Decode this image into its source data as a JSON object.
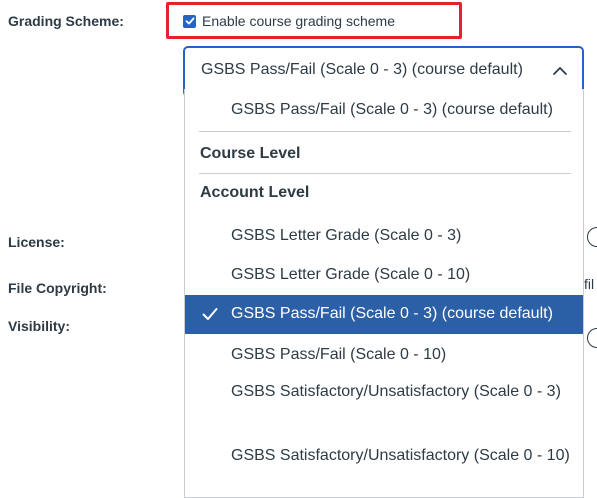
{
  "form": {
    "grading_scheme_label": "Grading Scheme:",
    "license_label": "License:",
    "file_copyright_label": "File Copyright:",
    "visibility_label": "Visibility:"
  },
  "enable_checkbox": {
    "label": "Enable course grading scheme",
    "checked": true
  },
  "select": {
    "value": "GSBS Pass/Fail (Scale 0 - 3) (course default)",
    "expanded": true
  },
  "dropdown": {
    "current_option": "GSBS Pass/Fail (Scale 0 - 3) (course default)",
    "course_level_header": "Course Level",
    "account_level_header": "Account Level",
    "options": [
      {
        "label": "GSBS Letter Grade (Scale 0 - 3)",
        "selected": false
      },
      {
        "label": "GSBS Letter Grade (Scale 0 - 10)",
        "selected": false
      },
      {
        "label": "GSBS Pass/Fail (Scale 0 - 3) (course default)",
        "selected": true
      },
      {
        "label": "GSBS Pass/Fail (Scale 0 - 10)",
        "selected": false
      },
      {
        "label": "GSBS Satisfactory/Unsatisfactory (Scale 0 - 3)",
        "selected": false
      },
      {
        "label": "GSBS Satisfactory/Unsatisfactory (Scale 0 - 10)",
        "selected": false
      }
    ]
  },
  "edge_text": "fil",
  "colors": {
    "highlight": "#e3232b",
    "accent": "#2563c9",
    "selected_bg": "#2b5fa6",
    "text": "#2d3b45"
  }
}
